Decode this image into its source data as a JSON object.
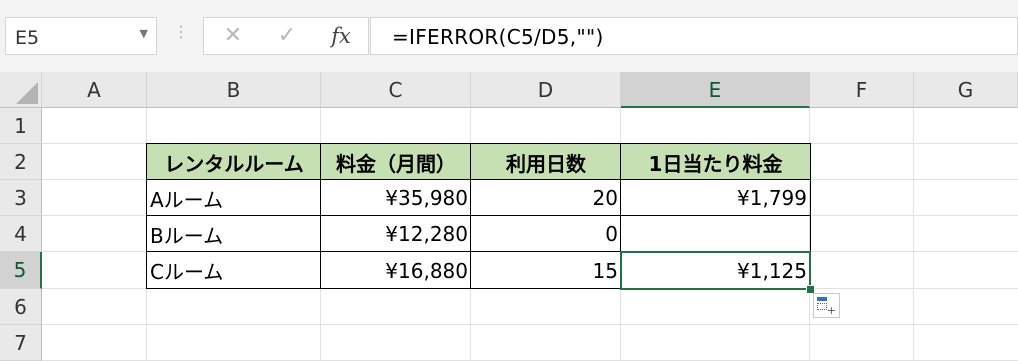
{
  "formula_bar": {
    "name_box": "E5",
    "cancel_icon": "✕",
    "enter_icon": "✓",
    "fx_label": "fx",
    "formula": "=IFERROR(C5/D5,\"\")"
  },
  "columns": [
    "A",
    "B",
    "C",
    "D",
    "E",
    "F",
    "G"
  ],
  "rows": [
    "1",
    "2",
    "3",
    "4",
    "5",
    "6",
    "7"
  ],
  "table": {
    "headers": [
      "レンタルルーム",
      "料金（月間）",
      "利用日数",
      "1日当たり料金"
    ],
    "rows": [
      [
        "Aルーム",
        "¥35,980",
        "20",
        "¥1,799"
      ],
      [
        "Bルーム",
        "¥12,280",
        "0",
        ""
      ],
      [
        "Cルーム",
        "¥16,880",
        "15",
        "¥1,125"
      ]
    ]
  },
  "selected_cell": "E5",
  "colors": {
    "header_fill": "#c6e0b4",
    "selection": "#217346"
  }
}
